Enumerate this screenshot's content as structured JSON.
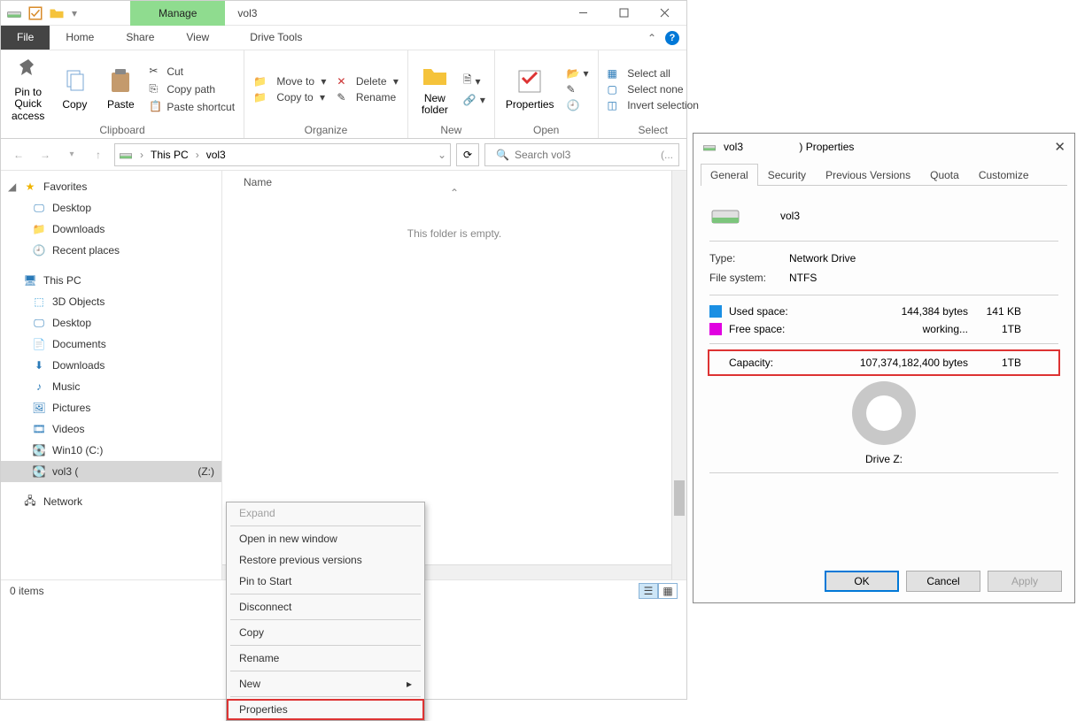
{
  "icons": {
    "drive": "drive-icon",
    "checkbox": "checkbox-icon",
    "folder": "folder-icon",
    "minimize": "minimize-icon",
    "maximize": "maximize-icon",
    "close": "close-icon",
    "chevron": "chevron-icon",
    "help": "help-icon",
    "pin": "pin-icon",
    "copy": "copy-icon",
    "paste": "paste-icon",
    "cut": "cut-icon",
    "copypath": "copy-path-icon",
    "pasteshort": "paste-shortcut-icon",
    "moveto": "move-to-icon",
    "copyto": "copy-to-icon",
    "delete": "delete-icon",
    "rename": "rename-icon",
    "newfolder": "new-folder-icon",
    "properties": "properties-icon",
    "open": "open-icon",
    "selectall": "select-all-icon",
    "selectnone": "select-none-icon",
    "invert": "invert-selection-icon",
    "refresh": "refresh-icon",
    "search": "search-icon",
    "star": "star-icon",
    "desktop": "desktop-icon",
    "downloads": "downloads-icon",
    "recent": "recent-icon",
    "pc": "this-pc-icon",
    "3d": "3d-objects-icon",
    "documents": "documents-icon",
    "music": "music-icon",
    "pictures": "pictures-icon",
    "videos": "videos-icon",
    "disk": "disk-icon",
    "netdrive": "network-drive-icon",
    "network": "network-icon"
  },
  "title": {
    "manage": "Manage",
    "name": "vol3",
    "drive_tools": "Drive Tools"
  },
  "menu": {
    "file": "File",
    "home": "Home",
    "share": "Share",
    "view": "View",
    "help": "?"
  },
  "ribbon": {
    "clipboard": {
      "label": "Clipboard",
      "pin": "Pin to Quick access",
      "copy": "Copy",
      "paste": "Paste",
      "cut": "Cut",
      "copypath": "Copy path",
      "pasteshort": "Paste shortcut"
    },
    "organize": {
      "label": "Organize",
      "moveto": "Move to",
      "copyto": "Copy to",
      "delete": "Delete",
      "rename": "Rename"
    },
    "new": {
      "label": "New",
      "newfolder": "New folder"
    },
    "open": {
      "label": "Open",
      "properties": "Properties"
    },
    "select": {
      "label": "Select",
      "all": "Select all",
      "none": "Select none",
      "invert": "Invert selection"
    }
  },
  "nav": {
    "crumbs": [
      "This PC",
      "vol3"
    ],
    "search_placeholder": "Search vol3"
  },
  "tree": {
    "fav": "Favorites",
    "desktop": "Desktop",
    "downloads": "Downloads",
    "recent": "Recent places",
    "pc": "This PC",
    "3d": "3D Objects",
    "desk2": "Desktop",
    "docs": "Documents",
    "dl2": "Downloads",
    "music": "Music",
    "pics": "Pictures",
    "vids": "Videos",
    "cdrive": "Win10 (C:)",
    "vol3": "vol3 (",
    "vol3_suffix": "(Z:)",
    "network": "Network"
  },
  "content": {
    "col_name": "Name",
    "empty": "This folder is empty."
  },
  "status": {
    "items": "0 items"
  },
  "ctx": {
    "expand": "Expand",
    "open_win": "Open in new window",
    "restore": "Restore previous versions",
    "pin": "Pin to Start",
    "disconnect": "Disconnect",
    "copy": "Copy",
    "rename": "Rename",
    "new": "New",
    "properties": "Properties"
  },
  "props": {
    "title_prefix": "vol3",
    "title_suffix": ") Properties",
    "tabs": [
      "General",
      "Security",
      "Previous Versions",
      "Quota",
      "Customize"
    ],
    "name": "vol3",
    "type_lbl": "Type:",
    "type_val": "Network Drive",
    "fs_lbl": "File system:",
    "fs_val": "NTFS",
    "used_lbl": "Used space:",
    "used_bytes": "144,384 bytes",
    "used_h": "141 KB",
    "free_lbl": "Free space:",
    "free_bytes": "working...",
    "free_h": "1TB",
    "cap_lbl": "Capacity:",
    "cap_bytes": "107,374,182,400 bytes",
    "cap_h": "1TB",
    "drive": "Drive Z:",
    "ok": "OK",
    "cancel": "Cancel",
    "apply": "Apply"
  }
}
